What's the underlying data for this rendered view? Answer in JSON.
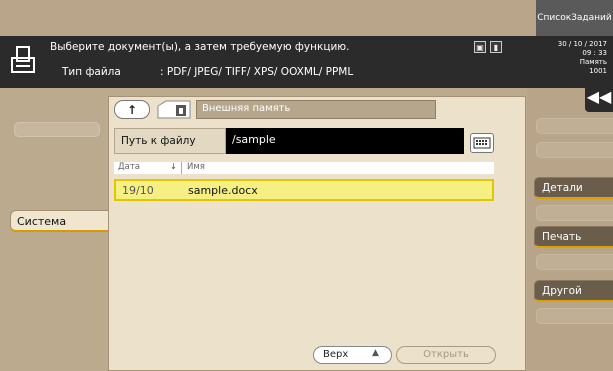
{
  "header": {
    "task_list": "СписокЗаданий",
    "message": "Выберите документ(ы), а затем требуемую функцию.",
    "file_type_label": "Тип файла",
    "file_type_value": ": PDF/ JPEG/ TIFF/ XPS/ OOXML/ PPML",
    "date": "30 / 10 / 2017",
    "time": "09 : 33",
    "memory_label": "Память",
    "memory_value": "1001"
  },
  "left_tab": "Система",
  "panel": {
    "storage_name": "Внешняя память",
    "path_label": "Путь к файлу",
    "path_value": "/sample",
    "column_date": "Дата",
    "column_name": "Имя",
    "files": [
      {
        "date": "19/10",
        "name": "sample.docx"
      }
    ],
    "top_button": "Верх",
    "open_button": "Открыть"
  },
  "right_menu": {
    "collapse_glyph": "◀◀",
    "details": "Детали",
    "print": "Печать",
    "other": "Другой"
  },
  "icons": {
    "up": "↑",
    "sort": "↓",
    "top_arrow": "▲"
  }
}
